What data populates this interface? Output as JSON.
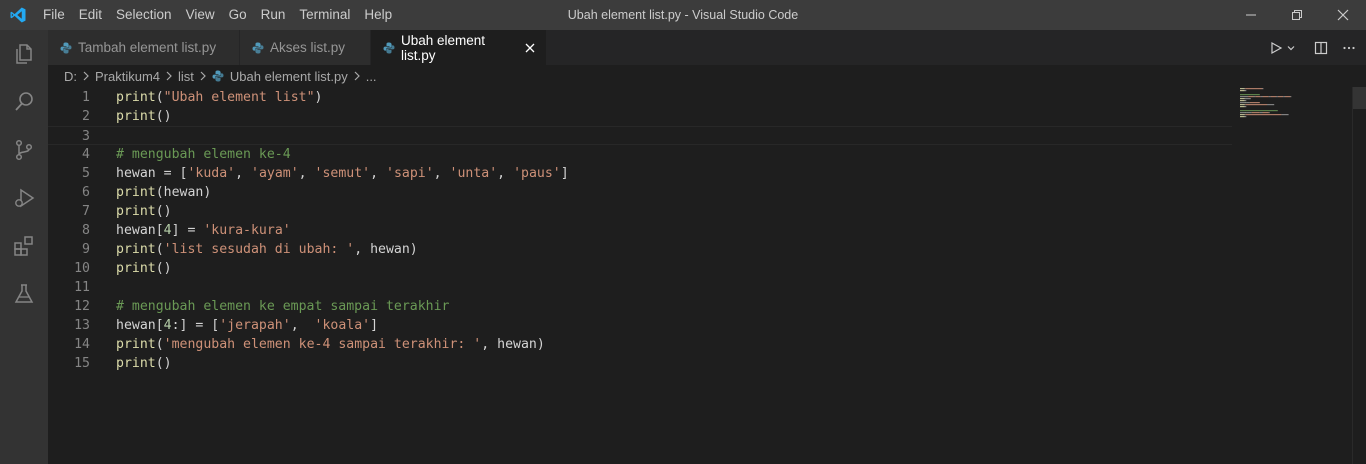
{
  "menu": [
    "File",
    "Edit",
    "Selection",
    "View",
    "Go",
    "Run",
    "Terminal",
    "Help"
  ],
  "window_title": "Ubah element list.py - Visual Studio Code",
  "tabs": [
    {
      "label": "Tambah element list.py",
      "active": false
    },
    {
      "label": "Akses list.py",
      "active": false
    },
    {
      "label": "Ubah element list.py",
      "active": true
    }
  ],
  "breadcrumb": {
    "drive": "D:",
    "folder1": "Praktikum4",
    "folder2": "list",
    "file": "Ubah element list.py",
    "more": "..."
  },
  "code_lines": [
    {
      "n": "1",
      "t": [
        [
          "kw-fn",
          "print"
        ],
        [
          "pl",
          "("
        ],
        [
          "str",
          "\"Ubah element list\""
        ],
        [
          "pl",
          ")"
        ]
      ]
    },
    {
      "n": "2",
      "t": [
        [
          "kw-fn",
          "print"
        ],
        [
          "pl",
          "()"
        ]
      ]
    },
    {
      "n": "3",
      "t": []
    },
    {
      "n": "4",
      "t": [
        [
          "cmt",
          "# mengubah elemen ke-4"
        ]
      ]
    },
    {
      "n": "5",
      "t": [
        [
          "pl",
          "hewan = ["
        ],
        [
          "str",
          "'kuda'"
        ],
        [
          "pl",
          ", "
        ],
        [
          "str",
          "'ayam'"
        ],
        [
          "pl",
          ", "
        ],
        [
          "str",
          "'semut'"
        ],
        [
          "pl",
          ", "
        ],
        [
          "str",
          "'sapi'"
        ],
        [
          "pl",
          ", "
        ],
        [
          "str",
          "'unta'"
        ],
        [
          "pl",
          ", "
        ],
        [
          "str",
          "'paus'"
        ],
        [
          "pl",
          "]"
        ]
      ]
    },
    {
      "n": "6",
      "t": [
        [
          "kw-fn",
          "print"
        ],
        [
          "pl",
          "(hewan)"
        ]
      ]
    },
    {
      "n": "7",
      "t": [
        [
          "kw-fn",
          "print"
        ],
        [
          "pl",
          "()"
        ]
      ]
    },
    {
      "n": "8",
      "t": [
        [
          "pl",
          "hewan["
        ],
        [
          "num",
          "4"
        ],
        [
          "pl",
          "] = "
        ],
        [
          "str",
          "'kura-kura'"
        ]
      ]
    },
    {
      "n": "9",
      "t": [
        [
          "kw-fn",
          "print"
        ],
        [
          "pl",
          "("
        ],
        [
          "str",
          "'list sesudah di ubah: '"
        ],
        [
          "pl",
          ", hewan)"
        ]
      ]
    },
    {
      "n": "10",
      "t": [
        [
          "kw-fn",
          "print"
        ],
        [
          "pl",
          "()"
        ]
      ]
    },
    {
      "n": "11",
      "t": []
    },
    {
      "n": "12",
      "t": [
        [
          "cmt",
          "# mengubah elemen ke empat sampai terakhir"
        ]
      ]
    },
    {
      "n": "13",
      "t": [
        [
          "pl",
          "hewan["
        ],
        [
          "num",
          "4"
        ],
        [
          "pl",
          ":] = ["
        ],
        [
          "str",
          "'jerapah'"
        ],
        [
          "pl",
          ",  "
        ],
        [
          "str",
          "'koala'"
        ],
        [
          "pl",
          "]"
        ]
      ]
    },
    {
      "n": "14",
      "t": [
        [
          "kw-fn",
          "print"
        ],
        [
          "pl",
          "("
        ],
        [
          "str",
          "'mengubah elemen ke-4 sampai terakhir: '"
        ],
        [
          "pl",
          ", hewan)"
        ]
      ]
    },
    {
      "n": "15",
      "t": [
        [
          "kw-fn",
          "print"
        ],
        [
          "pl",
          "()"
        ]
      ]
    }
  ],
  "current_line": "3",
  "colors": {
    "accent": "#007acc",
    "python_icon": "#519aba",
    "string": "#ce9178",
    "function": "#dcdcaa",
    "comment": "#6a9955",
    "number": "#b5cea8"
  }
}
